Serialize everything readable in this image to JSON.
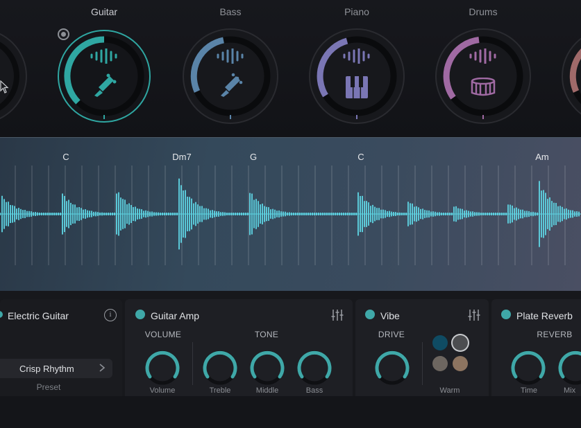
{
  "instruments": [
    {
      "label": "",
      "color": "#5a5c62"
    },
    {
      "label": "Guitar",
      "color": "#2fa7a2",
      "active": true
    },
    {
      "label": "Bass",
      "color": "#5a84a8"
    },
    {
      "label": "Piano",
      "color": "#7a76b4"
    },
    {
      "label": "Drums",
      "color": "#a06aa3"
    },
    {
      "label": "",
      "color": "#a06a6a"
    }
  ],
  "chords": [
    {
      "label": "C"
    },
    {
      "label": "Dm7"
    },
    {
      "label": "G"
    },
    {
      "label": "C"
    },
    {
      "label": "Am"
    }
  ],
  "wave_color": "#5fd7e6",
  "source": {
    "title": "Electric Guitar",
    "preset_value": "Crisp Rhythm",
    "preset_label": "Preset"
  },
  "amp": {
    "title": "Guitar Amp",
    "volume_section": "VOLUME",
    "tone_section": "TONE",
    "knobs": {
      "volume": "Volume",
      "treble": "Treble",
      "middle": "Middle",
      "bass": "Bass"
    }
  },
  "vibe": {
    "title": "Vibe",
    "drive_section": "DRIVE",
    "warm_label": "Warm",
    "swatches": [
      "#0f4b63",
      "#4c4d50",
      "#6d6660",
      "#8d7460"
    ]
  },
  "reverb": {
    "title": "Plate Reverb",
    "section": "REVERB",
    "knobs": {
      "time": "Time",
      "mix": "Mix"
    }
  },
  "accent": "#3fa8a8"
}
